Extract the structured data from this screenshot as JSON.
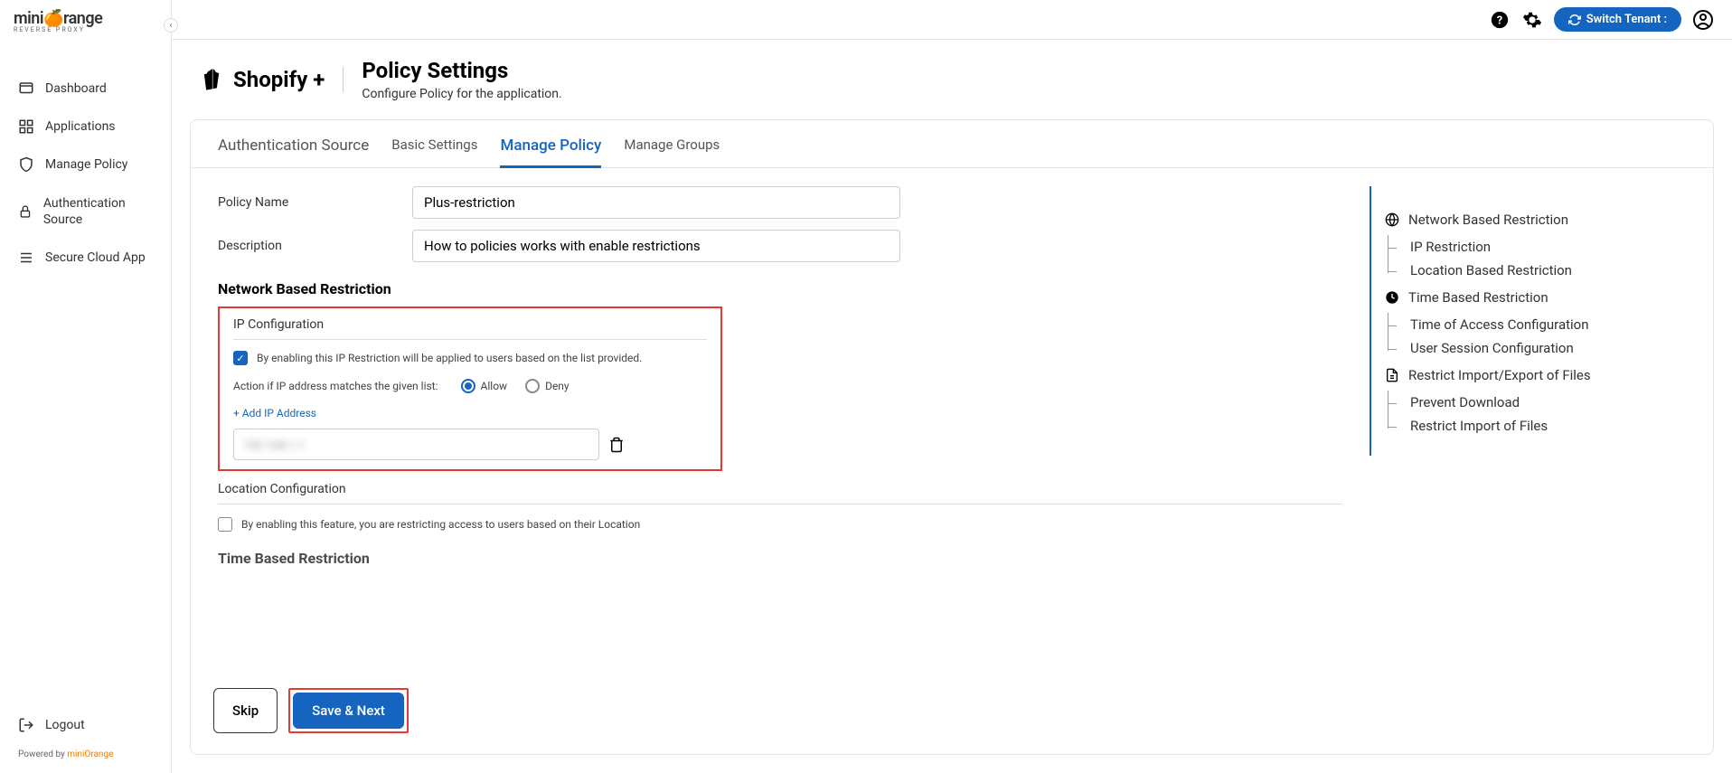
{
  "brand": {
    "name_part1": "mini",
    "name_part2": "range",
    "sub": "REVERSE PROXY"
  },
  "sidebar": {
    "items": [
      {
        "label": "Dashboard"
      },
      {
        "label": "Applications"
      },
      {
        "label": "Manage Policy"
      },
      {
        "label": "Authentication Source"
      },
      {
        "label": "Secure Cloud App"
      }
    ],
    "logout": "Logout",
    "powered_prefix": "Powered by ",
    "powered_link": "miniOrange"
  },
  "topbar": {
    "switch_tenant": "Switch Tenant :"
  },
  "header": {
    "app_name": "Shopify +",
    "title": "Policy Settings",
    "subtitle": "Configure Policy for the application."
  },
  "tabs": [
    {
      "label": "Authentication Source",
      "active": false
    },
    {
      "label": "Basic Settings",
      "active": false
    },
    {
      "label": "Manage Policy",
      "active": true
    },
    {
      "label": "Manage Groups",
      "active": false
    }
  ],
  "form": {
    "policy_name_label": "Policy Name",
    "policy_name_value": "Plus-restriction",
    "description_label": "Description",
    "description_value": "How to policies works with enable restrictions",
    "network_section": "Network Based Restriction",
    "ip_config_title": "IP Configuration",
    "ip_enable_text": "By enabling this IP Restriction will be applied to users based on the list provided.",
    "action_label": "Action if IP address matches the given list:",
    "allow": "Allow",
    "deny": "Deny",
    "add_ip": "+ Add IP Address",
    "location_title": "Location Configuration",
    "location_enable_text": "By enabling this feature, you are restricting access to users based on their Location",
    "time_section": "Time Based Restriction"
  },
  "side_nav": [
    {
      "label": "Network Based Restriction",
      "icon": "globe",
      "children": [
        "IP Restriction",
        "Location Based Restriction"
      ]
    },
    {
      "label": "Time Based Restriction",
      "icon": "clock",
      "children": [
        "Time of Access Configuration",
        "User Session Configuration"
      ]
    },
    {
      "label": "Restrict Import/Export of Files",
      "icon": "file",
      "children": [
        "Prevent Download",
        "Restrict Import of Files"
      ]
    }
  ],
  "buttons": {
    "skip": "Skip",
    "save_next": "Save & Next"
  }
}
